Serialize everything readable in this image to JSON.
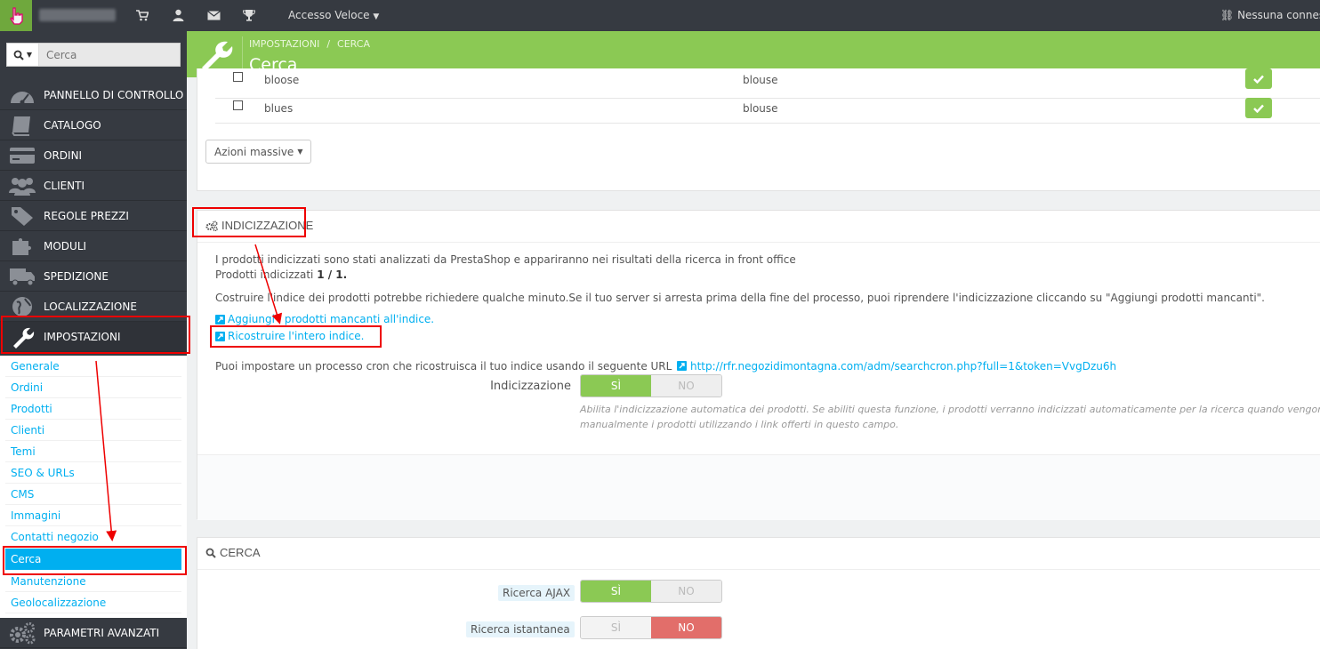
{
  "topbar": {
    "quick_access": "Accesso Veloce",
    "connection": "Nessuna connessione",
    "icons": [
      "cart-icon",
      "user-icon",
      "envelope-icon",
      "trophy-icon"
    ]
  },
  "sidebar": {
    "search_placeholder": "Cerca",
    "menu": [
      {
        "label": "PANNELLO DI CONTROLLO",
        "icon": "dashboard-icon"
      },
      {
        "label": "CATALOGO",
        "icon": "book-icon"
      },
      {
        "label": "ORDINI",
        "icon": "credit-card-icon"
      },
      {
        "label": "CLIENTI",
        "icon": "users-icon"
      },
      {
        "label": "REGOLE PREZZI",
        "icon": "tag-icon"
      },
      {
        "label": "MODULI",
        "icon": "puzzle-icon"
      },
      {
        "label": "SPEDIZIONE",
        "icon": "truck-icon"
      },
      {
        "label": "LOCALIZZAZIONE",
        "icon": "globe-icon"
      },
      {
        "label": "IMPOSTAZIONI",
        "icon": "wrench-icon"
      },
      {
        "label": "PARAMETRI AVANZATI",
        "icon": "cogs-icon"
      }
    ],
    "submenu": [
      "Generale",
      "Ordini",
      "Prodotti",
      "Clienti",
      "Temi",
      "SEO & URLs",
      "CMS",
      "Immagini",
      "Contatti negozio",
      "Cerca",
      "Manutenzione",
      "Geolocalizzazione"
    ]
  },
  "header": {
    "breadcrumb": [
      "IMPOSTAZIONI",
      "/",
      "CERCA"
    ],
    "title": "Cerca"
  },
  "aliases": {
    "rows": [
      {
        "alias": "bloose",
        "search": "blouse"
      },
      {
        "alias": "blues",
        "search": "blouse"
      }
    ],
    "bulk_actions": "Azioni massive"
  },
  "indexing": {
    "title": "INDICIZZAZIONE",
    "line1": "I prodotti indicizzati sono stati analizzati da PrestaShop e appariranno nei risultati della ricerca in front office",
    "line2_prefix": "Prodotti indicizzati",
    "line2_count": "1 / 1.",
    "line3": "Costruire l'indice dei prodotti potrebbe richiedere qualche minuto.Se il tuo server si arresta prima della fine del processo, puoi riprendere l'indicizzazione cliccando su \"Aggiungi prodotti mancanti\".",
    "link_add": "Aggiungi i prodotti mancanti all'indice.",
    "link_rebuild": "Ricostruire l'intero indice.",
    "cron_text": "Puoi impostare un processo cron che ricostruisca il tuo indice usando il seguente URL",
    "cron_url": "http://rfr.negozidimontagna.com/adm/searchcron.php?full=1&token=VvgDzu6h",
    "switch_label": "Indicizzazione",
    "yes": "SÌ",
    "no": "NO",
    "help_line1": "Abilita l'indicizzazione automatica dei prodotti. Se abiliti questa funzione, i prodotti verranno indicizzati automaticamente per la ricerca quando vengono",
    "help_line2": "manualmente i prodotti utilizzando i link offerti in questo campo."
  },
  "search": {
    "title": "CERCA",
    "ajax_label": "Ricerca AJAX",
    "instant_label": "Ricerca istantanea",
    "yes": "SÌ",
    "no": "NO"
  },
  "colors": {
    "accent_green": "#8bc954",
    "accent_blue": "#00aff0",
    "danger_red": "#e26e6a",
    "sidebar_dark": "#363a41"
  }
}
